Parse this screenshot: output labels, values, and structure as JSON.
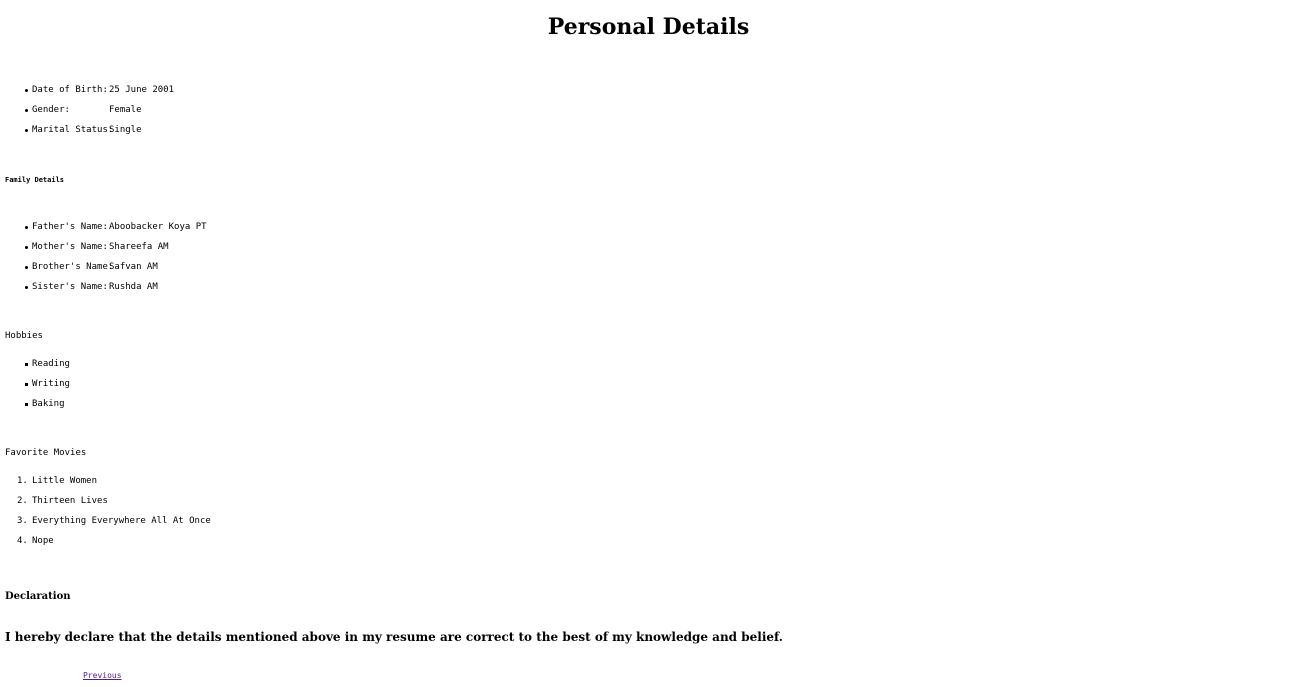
{
  "page": {
    "title": "Personal Details"
  },
  "personal": [
    {
      "label": "Date of Birth:",
      "value": "25 June 2001"
    },
    {
      "label": "Gender:",
      "value": "Female"
    },
    {
      "label": "Marital Status:",
      "value": "Single"
    }
  ],
  "family": {
    "heading": "Family Details",
    "items": [
      {
        "label": "Father's Name:",
        "value": "Aboobacker Koya PT"
      },
      {
        "label": "Mother's Name:",
        "value": "Shareefa AM"
      },
      {
        "label": "Brother's Name:",
        "value": "Safvan AM"
      },
      {
        "label": "Sister's Name:",
        "value": "Rushda AM"
      }
    ]
  },
  "hobbies": {
    "heading": "Hobbies",
    "items": [
      "Reading",
      "Writing",
      "Baking"
    ]
  },
  "movies": {
    "heading": "Favorite Movies",
    "items": [
      {
        "num": "1.",
        "title": "Little Women"
      },
      {
        "num": "2.",
        "title": "Thirteen Lives"
      },
      {
        "num": "3.",
        "title": "Everything Everywhere All At Once"
      },
      {
        "num": "4.",
        "title": "Nope"
      }
    ]
  },
  "declaration": {
    "heading": "Declaration",
    "text": "I hereby declare that the details mentioned above in my resume are correct to the best of my knowledge and belief."
  },
  "nav": {
    "previous_label": "Previous"
  }
}
